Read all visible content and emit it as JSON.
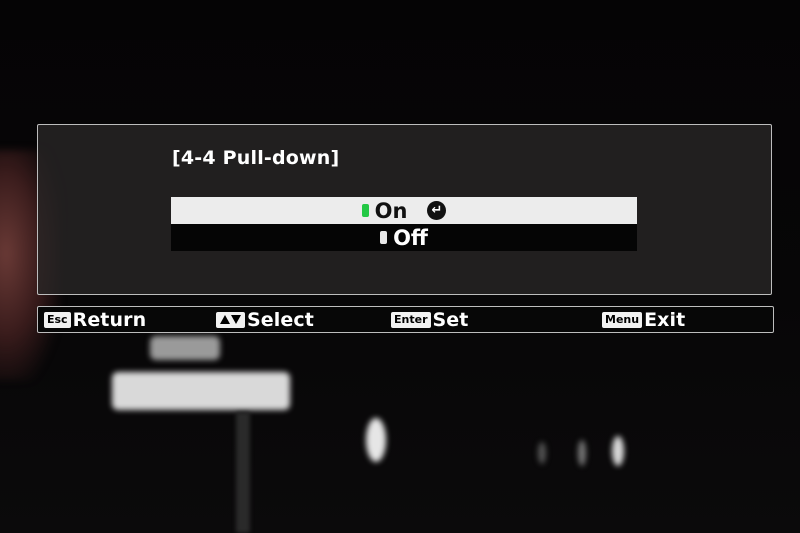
{
  "menu": {
    "title": "[4-4 Pull-down]",
    "options": [
      {
        "label": "On",
        "selected": true
      },
      {
        "label": "Off",
        "selected": false
      }
    ]
  },
  "help_bar": {
    "return": {
      "key": "Esc",
      "label": "Return"
    },
    "select": {
      "key_icon": "up-down-arrows-icon",
      "label": "Select"
    },
    "set": {
      "key": "Enter",
      "label": "Set"
    },
    "exit": {
      "key": "Menu",
      "label": "Exit"
    }
  },
  "colors": {
    "selected_indicator": "#23c845",
    "highlight_row": "#ececec",
    "panel_border": "#bdbdbd"
  },
  "icons": {
    "selected_row_icon": "enter-return-icon"
  }
}
